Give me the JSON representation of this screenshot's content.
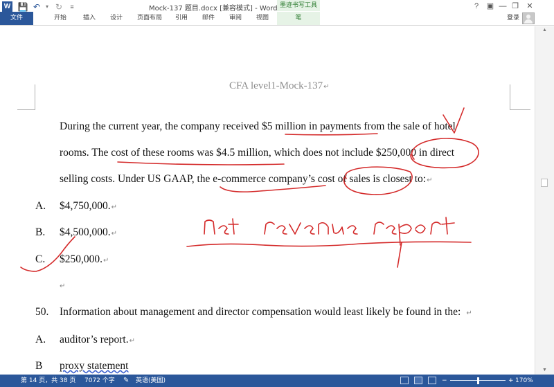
{
  "app": {
    "title": "Mock-137 题目.docx [兼容模式] - Word",
    "logo_letter": "W",
    "ink_tools_group": "墨迹书写工具",
    "login": "登录"
  },
  "qat_icons": [
    "save-icon",
    "undo-icon",
    "redo-icon",
    "customize-icon"
  ],
  "window_controls": [
    "help-icon",
    "ribbon-display-icon",
    "minimize-icon",
    "restore-icon",
    "close-icon"
  ],
  "tabs": [
    {
      "label": "文件"
    },
    {
      "label": "开始"
    },
    {
      "label": "插入"
    },
    {
      "label": "设计"
    },
    {
      "label": "页面布局"
    },
    {
      "label": "引用"
    },
    {
      "label": "邮件"
    },
    {
      "label": "审阅"
    },
    {
      "label": "视图"
    },
    {
      "label": "笔"
    }
  ],
  "document": {
    "header": "CFA level1-Mock-137",
    "question_lines": [
      "During the current year, the company received $5 million in payments from the sale of hotel",
      "rooms. The cost of these rooms was $4.5 million, which does not include $250,000 in direct",
      "selling costs. Under US GAAP, the e-commerce company’s cost of sales is closest to:"
    ],
    "options": [
      {
        "letter": "A.",
        "text": "$4,750,000."
      },
      {
        "letter": "B.",
        "text": "$4,500,000."
      },
      {
        "letter": "C.",
        "text": "$250,000."
      }
    ],
    "q50": {
      "number": "50.",
      "text": "Information about management and director compensation would least likely be found in the:",
      "options": [
        {
          "letter": "A.",
          "text": "auditor’s report."
        },
        {
          "letter": "B",
          "text": "proxy statement"
        }
      ]
    },
    "handwriting": "net revenue report",
    "para_mark": "↵"
  },
  "status": {
    "page": "第 14 页，共 38 页",
    "words": "7072 个字",
    "language": "英语(美国)",
    "zoom": "170%",
    "zoom_level_fraction": 0.5
  },
  "colors": {
    "accent": "#2b579a",
    "ink": "#d42a2a",
    "pen_tab": "#e6f3e6"
  }
}
